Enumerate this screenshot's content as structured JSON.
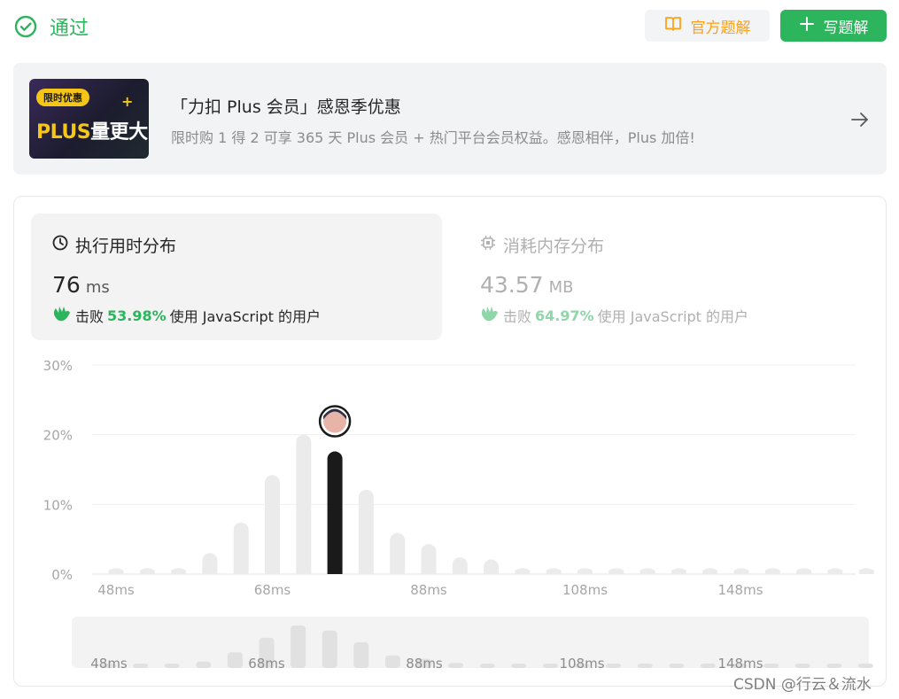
{
  "header": {
    "status_label": "通过",
    "official_solution_label": "官方题解",
    "write_solution_label": "写题解",
    "accent_color": "#2db55d",
    "solution_color": "#ffa116"
  },
  "promo": {
    "badge": "限时优惠",
    "image_text_plus": "PLUS",
    "image_text_more": "量更大",
    "title": "「力扣 Plus 会员」感恩季优惠",
    "subtitle": "限时购 1 得 2 可享 365 天 Plus 会员 + 热门平台会员权益。感恩相伴，Plus 加倍!"
  },
  "runtime": {
    "title": "执行用时分布",
    "value": "76",
    "unit": "ms",
    "beats_prefix": "击败",
    "beats_pct": "53.98%",
    "beats_suffix": "使用 JavaScript 的用户"
  },
  "memory": {
    "title": "消耗内存分布",
    "value": "43.57",
    "unit": "MB",
    "beats_prefix": "击败",
    "beats_pct": "64.97%",
    "beats_suffix": "使用 JavaScript 的用户"
  },
  "chart_data": {
    "type": "bar",
    "y_ticks": [
      "30%",
      "20%",
      "10%",
      "0%"
    ],
    "ylim": [
      0,
      30
    ],
    "x_tick_labels": [
      "48ms",
      "68ms",
      "88ms",
      "108ms",
      "148ms"
    ],
    "categories": [
      "48ms",
      "52ms",
      "56ms",
      "60ms",
      "64ms",
      "68ms",
      "72ms",
      "76ms",
      "80ms",
      "84ms",
      "88ms",
      "92ms",
      "96ms",
      "100ms",
      "104ms",
      "108ms",
      "112ms",
      "116ms",
      "120ms",
      "124ms",
      "128ms",
      "132ms",
      "136ms",
      "140ms",
      "144ms"
    ],
    "values": [
      0.9,
      0.9,
      0.9,
      3.0,
      7.4,
      14.2,
      20.0,
      17.6,
      12.1,
      5.9,
      4.3,
      2.4,
      2.1,
      0.9,
      0.9,
      0.9,
      0.9,
      0.9,
      0.9,
      0.9,
      0.9,
      0.9,
      0.9,
      0.9,
      0.9
    ],
    "highlight_category": "76ms",
    "bar_color": "#ebebeb",
    "highlight_color": "#1a1a1a",
    "grid": true,
    "overview_tick_labels": [
      "48ms",
      "68ms",
      "88ms",
      "108ms",
      "148ms"
    ]
  },
  "watermark": "CSDN @行云＆流水"
}
